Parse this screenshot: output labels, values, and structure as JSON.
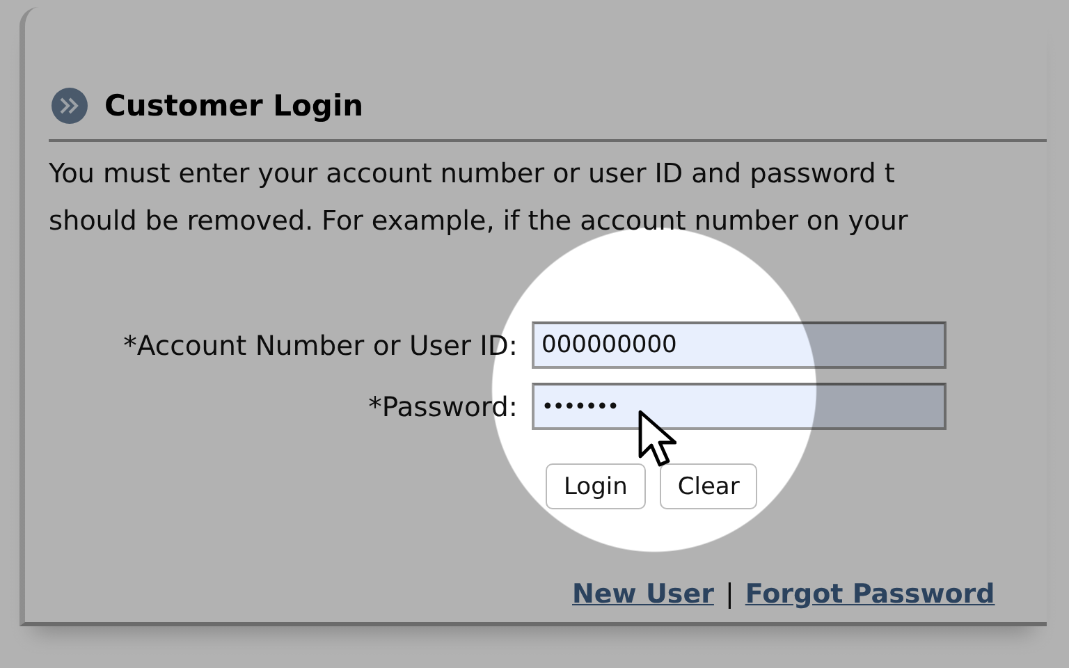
{
  "section": {
    "title": "Customer Login"
  },
  "instructions": [
    "You must enter your account number or user ID and password t",
    "should be removed. For example, if the account number on your"
  ],
  "fields": [
    {
      "kind": "text",
      "label": "*Account Number or User ID:",
      "value": "000000000"
    },
    {
      "kind": "password",
      "label": "*Password:",
      "value": "•••••••"
    }
  ],
  "buttons": [
    "Login",
    "Clear"
  ],
  "links": [
    {
      "label": "New User"
    },
    {
      "label": "Forgot Password"
    }
  ],
  "link_separator": "|"
}
